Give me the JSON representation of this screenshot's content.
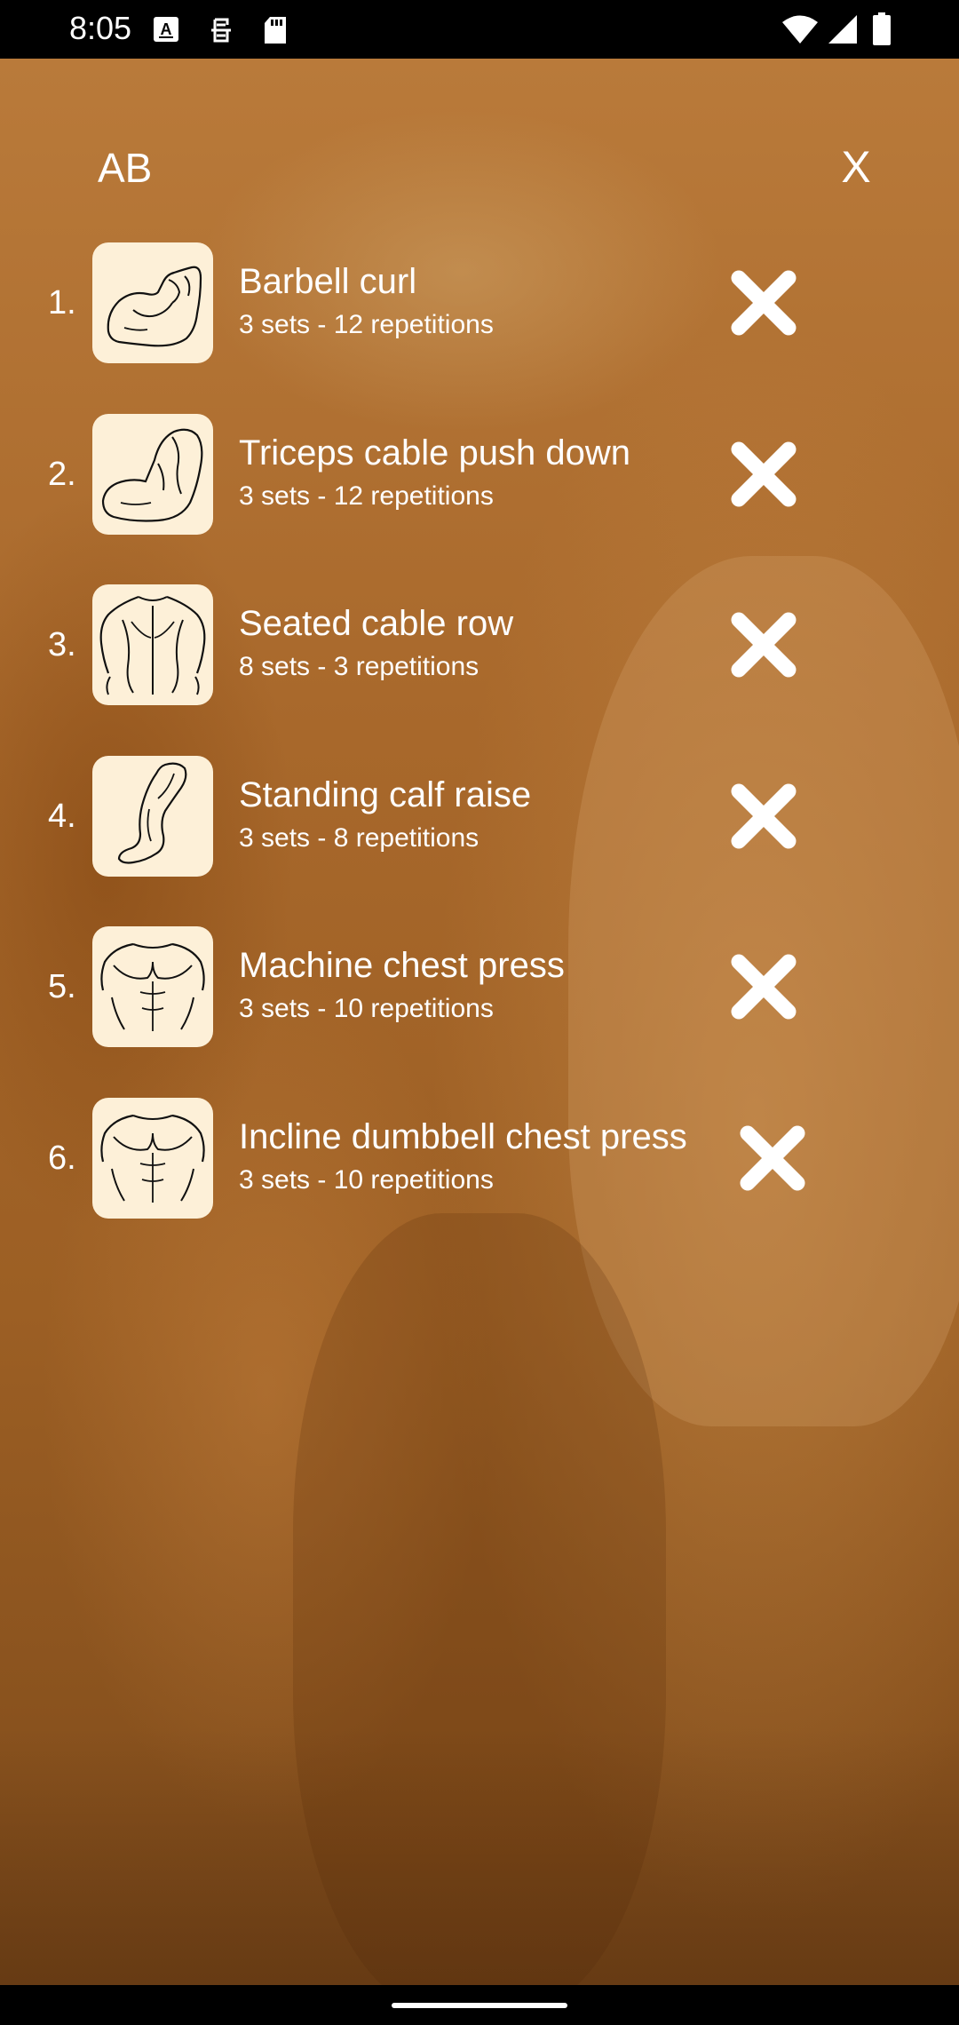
{
  "status_bar": {
    "time": "8:05",
    "icons": [
      "a-box-icon",
      "sim-icon",
      "sd-card-icon",
      "wifi-icon",
      "signal-icon",
      "battery-icon"
    ]
  },
  "header": {
    "title": "AB",
    "close_label": "X"
  },
  "exercises": [
    {
      "number": "1.",
      "name": "Barbell curl",
      "detail": "3 sets - 12 repetitions",
      "icon": "biceps-flex-icon"
    },
    {
      "number": "2.",
      "name": "Triceps cable push down",
      "detail": "3 sets - 12 repetitions",
      "icon": "arm-triceps-icon"
    },
    {
      "number": "3.",
      "name": "Seated cable row",
      "detail": "8 sets - 3 repetitions",
      "icon": "back-muscles-icon"
    },
    {
      "number": "4.",
      "name": "Standing calf raise",
      "detail": "3 sets - 8 repetitions",
      "icon": "leg-calf-icon"
    },
    {
      "number": "5.",
      "name": "Machine chest press",
      "detail": "3 sets - 10 repetitions",
      "icon": "chest-muscles-icon"
    },
    {
      "number": "6.",
      "name": "Incline dumbbell chest press",
      "detail": "3 sets - 10 repetitions",
      "icon": "chest-muscles-icon"
    }
  ],
  "colors": {
    "thumb_background": "#fdf0d8",
    "overlay_tint": "#b97a3a",
    "text": "#ffffff"
  }
}
